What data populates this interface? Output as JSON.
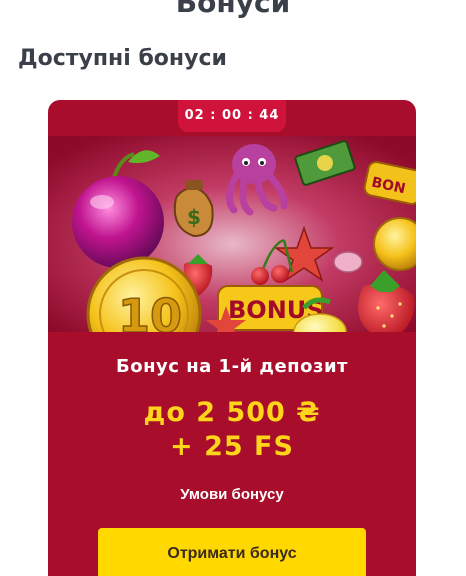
{
  "header": {
    "title": "Бонуси"
  },
  "section": {
    "title": "Доступні бонуси"
  },
  "card": {
    "timer": "02 : 00 : 44",
    "banner_texts": {
      "coin_number": "10",
      "bonus_sign": "BONUS",
      "bonus_sign_small": "BON",
      "dollar_sign": "$"
    },
    "offer_title": "Бонус на 1-й депозит",
    "amount_line1": "до 2 500 ₴",
    "amount_line2": "+ 25 FS",
    "terms_label": "Умови бонусу",
    "cta_label": "Отримати бонус"
  },
  "colors": {
    "card_bg": "#a80d2b",
    "timer_bg": "#d0133a",
    "amount": "#ffd51c",
    "cta_bg": "#ffd800"
  },
  "icons": [
    "plum-icon",
    "money-bag-icon",
    "octopus-icon",
    "cash-stack-icon",
    "starfish-icon",
    "cherries-icon",
    "strawberry-icon",
    "lemon-icon",
    "gold-coin-icon",
    "bonus-sign-icon"
  ]
}
